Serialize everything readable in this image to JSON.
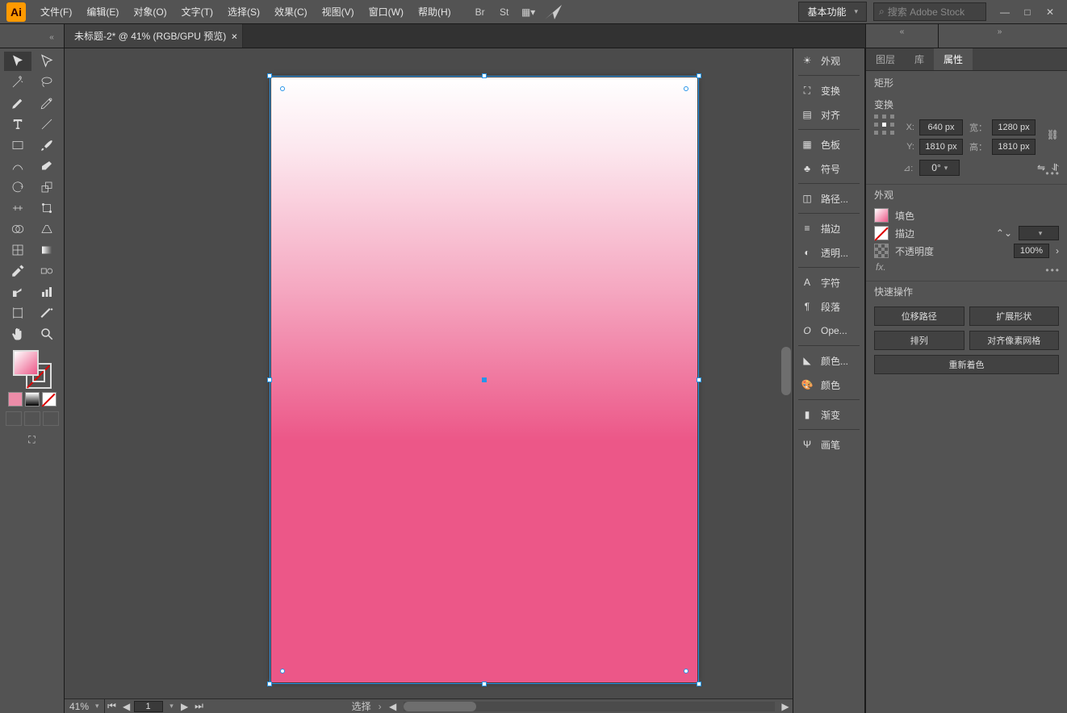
{
  "app": {
    "logo": "Ai"
  },
  "menu": [
    "文件(F)",
    "编辑(E)",
    "对象(O)",
    "文字(T)",
    "选择(S)",
    "效果(C)",
    "视图(V)",
    "窗口(W)",
    "帮助(H)"
  ],
  "topbar": {
    "workspace": "基本功能",
    "search_placeholder": "搜索 Adobe Stock"
  },
  "document": {
    "tab_title": "未标题-2* @ 41% (RGB/GPU 预览)",
    "zoom": "41%",
    "page": "1",
    "status": "选择"
  },
  "midstrip": [
    {
      "icon": "sun",
      "label": "外观"
    },
    {
      "icon": "transform",
      "label": "变换"
    },
    {
      "icon": "align",
      "label": "对齐"
    },
    {
      "icon": "swatches",
      "label": "色板"
    },
    {
      "icon": "symbols",
      "label": "符号"
    },
    {
      "icon": "pathfinder",
      "label": "路径..."
    },
    {
      "icon": "stroke",
      "label": "描边"
    },
    {
      "icon": "transparency",
      "label": "透明..."
    },
    {
      "icon": "character",
      "label": "字符"
    },
    {
      "icon": "paragraph",
      "label": "段落"
    },
    {
      "icon": "opentype",
      "label": "Ope..."
    },
    {
      "icon": "colorguide",
      "label": "颜色..."
    },
    {
      "icon": "color",
      "label": "颜色"
    },
    {
      "icon": "gradient",
      "label": "渐变"
    },
    {
      "icon": "brushes",
      "label": "画笔"
    }
  ],
  "props": {
    "tabs": [
      "图层",
      "库",
      "属性"
    ],
    "shape_type": "矩形",
    "transform": {
      "header": "变换",
      "x_label": "X:",
      "x": "640 px",
      "w_label": "宽：",
      "w": "1280 px",
      "y_label": "Y:",
      "y": "1810 px",
      "h_label": "高：",
      "h": "1810 px",
      "angle_label": "⊿:",
      "angle": "0°"
    },
    "appearance": {
      "header": "外观",
      "fill_label": "填色",
      "stroke_label": "描边",
      "opacity_label": "不透明度",
      "opacity": "100%",
      "fx": "fx."
    },
    "quick": {
      "header": "快速操作",
      "offset": "位移路径",
      "expand": "扩展形状",
      "arrange": "排列",
      "align_pixel": "对齐像素网格",
      "recolor": "重新着色"
    }
  }
}
